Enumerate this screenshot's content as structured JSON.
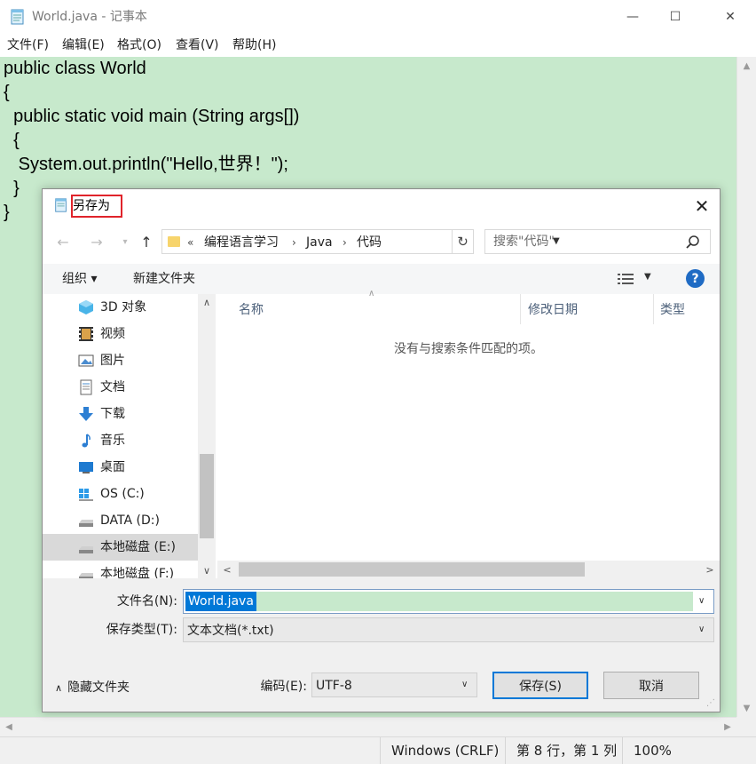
{
  "window": {
    "title": "World.java - 记事本",
    "controls": {
      "minimize": "—",
      "maximize": "☐",
      "close": "✕"
    }
  },
  "menu": [
    "文件(F)",
    "编辑(E)",
    "格式(O)",
    "查看(V)",
    "帮助(H)"
  ],
  "editor": {
    "lines": [
      "public class World",
      "{",
      "  public static void main (String args[])",
      "  {",
      "   System.out.println(\"Hello,世界！\");",
      "  }",
      "}"
    ],
    "background": "#c7e9cc"
  },
  "status": {
    "line_ending": "Windows (CRLF)",
    "position": "第 8 行，第 1 列",
    "zoom": "100%"
  },
  "dialog": {
    "title": "另存为",
    "close": "✕",
    "address": {
      "overflow": "«",
      "segments": [
        "编程语言学习",
        "Java",
        "代码"
      ]
    },
    "search_placeholder": "搜索\"代码\"",
    "toolbar": {
      "organize": "组织 ▾",
      "new_folder": "新建文件夹",
      "help": "?"
    },
    "nav_items": [
      {
        "label": "3D 对象",
        "icon": "cube-3d-icon"
      },
      {
        "label": "视频",
        "icon": "video-icon"
      },
      {
        "label": "图片",
        "icon": "pictures-icon"
      },
      {
        "label": "文档",
        "icon": "documents-icon"
      },
      {
        "label": "下载",
        "icon": "download-icon"
      },
      {
        "label": "音乐",
        "icon": "music-icon"
      },
      {
        "label": "桌面",
        "icon": "desktop-icon"
      },
      {
        "label": "OS (C:)",
        "icon": "windows-drive-icon"
      },
      {
        "label": "DATA (D:)",
        "icon": "drive-icon"
      },
      {
        "label": "本地磁盘 (E:)",
        "icon": "drive-icon",
        "selected": true
      },
      {
        "label": "本地磁盘 (F:)",
        "icon": "drive-icon"
      }
    ],
    "columns": [
      "名称",
      "修改日期",
      "类型"
    ],
    "empty_message": "没有与搜索条件匹配的项。",
    "filename_label": "文件名(N):",
    "filename_value": "World.java",
    "filetype_label": "保存类型(T):",
    "filetype_value": "文本文档(*.txt)",
    "hide_folders": "隐藏文件夹",
    "encoding_label": "编码(E):",
    "encoding_value": "UTF-8",
    "save_button": "保存(S)",
    "cancel_button": "取消",
    "highlight_color": "#e0242b",
    "accent_color": "#0078d7"
  }
}
